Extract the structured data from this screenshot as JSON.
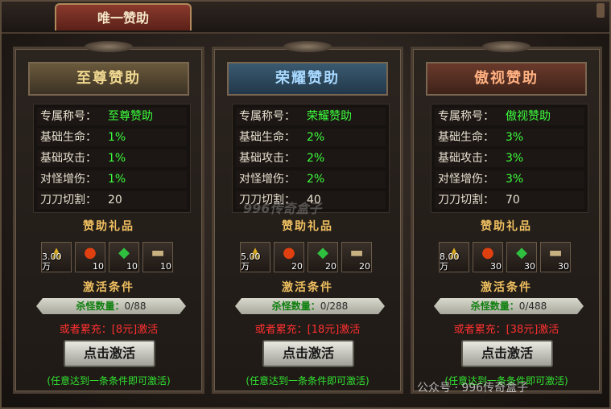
{
  "window": {
    "title": "唯一赞助"
  },
  "panels": [
    {
      "name": "至尊赞助",
      "stats": [
        {
          "label": "专属称号：",
          "value": "至尊赞助"
        },
        {
          "label": "基础生命：",
          "value": "1%"
        },
        {
          "label": "基础攻击：",
          "value": "1%"
        },
        {
          "label": "对怪增伤：",
          "value": "1%"
        },
        {
          "label": "刀刀切割：",
          "value": "20"
        }
      ],
      "gift_title": "赞助礼品",
      "gifts": [
        {
          "icon": "gold-ingot-icon",
          "qty": "3.00万"
        },
        {
          "icon": "red-orb-icon",
          "qty": "10"
        },
        {
          "icon": "green-gem-icon",
          "qty": "10"
        },
        {
          "icon": "scroll-icon",
          "qty": "10"
        }
      ],
      "cond_title": "激活条件",
      "kill_label": "杀怪数量：",
      "kill_value": "0/88",
      "kill_progress": 0,
      "recharge_prefix": "或者累充：",
      "recharge_amount": "[8元]",
      "recharge_suffix": "激活",
      "button": "点击激活",
      "hint": "(任意达到一条条件即可激活)"
    },
    {
      "name": "荣耀赞助",
      "stats": [
        {
          "label": "专属称号：",
          "value": "荣耀赞助"
        },
        {
          "label": "基础生命：",
          "value": "2%"
        },
        {
          "label": "基础攻击：",
          "value": "2%"
        },
        {
          "label": "对怪增伤：",
          "value": "2%"
        },
        {
          "label": "刀刀切割：",
          "value": "40"
        }
      ],
      "gift_title": "赞助礼品",
      "gifts": [
        {
          "icon": "gold-ingot-icon",
          "qty": "5.00万"
        },
        {
          "icon": "red-orb-icon",
          "qty": "20"
        },
        {
          "icon": "green-gem-icon",
          "qty": "20"
        },
        {
          "icon": "scroll-icon",
          "qty": "20"
        }
      ],
      "cond_title": "激活条件",
      "kill_label": "杀怪数量：",
      "kill_value": "0/288",
      "kill_progress": 0,
      "recharge_prefix": "或者累充：",
      "recharge_amount": "[18元]",
      "recharge_suffix": "激活",
      "button": "点击激活",
      "hint": "(任意达到一条条件即可激活)"
    },
    {
      "name": "傲视赞助",
      "stats": [
        {
          "label": "专属称号：",
          "value": "傲视赞助"
        },
        {
          "label": "基础生命：",
          "value": "3%"
        },
        {
          "label": "基础攻击：",
          "value": "3%"
        },
        {
          "label": "对怪增伤：",
          "value": "3%"
        },
        {
          "label": "刀刀切割：",
          "value": "70"
        }
      ],
      "gift_title": "赞助礼品",
      "gifts": [
        {
          "icon": "gold-ingot-icon",
          "qty": "8.00万"
        },
        {
          "icon": "red-orb-icon",
          "qty": "30"
        },
        {
          "icon": "green-gem-icon",
          "qty": "30"
        },
        {
          "icon": "scroll-icon",
          "qty": "30"
        }
      ],
      "cond_title": "激活条件",
      "kill_label": "杀怪数量：",
      "kill_value": "0/488",
      "kill_progress": 0,
      "recharge_prefix": "或者累充：",
      "recharge_amount": "[38元]",
      "recharge_suffix": "激活",
      "button": "点击激活",
      "hint": "(任意达到一条条件即可激活)"
    }
  ],
  "watermarks": {
    "center": "996传奇盒子",
    "bottom": "公众号 · 996传奇盒子"
  }
}
